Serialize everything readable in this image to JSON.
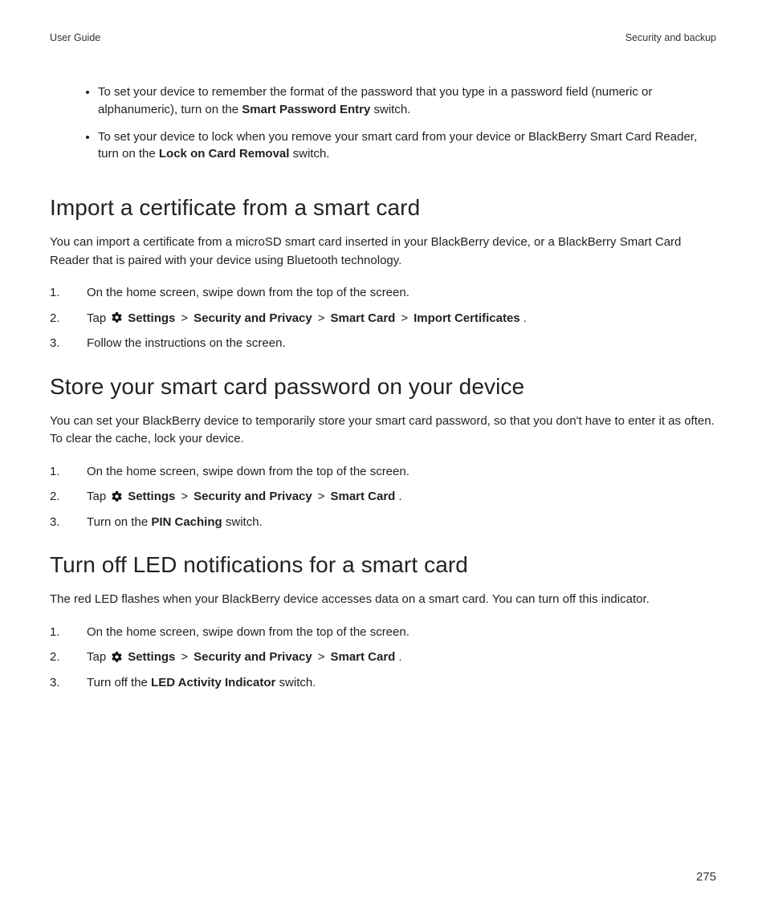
{
  "header": {
    "left": "User Guide",
    "right": "Security and backup"
  },
  "page_number": "275",
  "top_bullets": [
    {
      "pre": "To set your device to remember the format of the password that you type in a password field (numeric or alphanumeric), turn on the ",
      "bold": "Smart Password Entry",
      "post": " switch."
    },
    {
      "pre": "To set your device to lock when you remove your smart card from your device or BlackBerry Smart Card Reader, turn on the ",
      "bold": "Lock on Card Removal",
      "post": " switch."
    }
  ],
  "sections": {
    "import": {
      "heading": "Import a certificate from a smart card",
      "intro": "You can import a certificate from a microSD smart card inserted in your BlackBerry device, or a BlackBerry Smart Card Reader that is paired with your device using Bluetooth technology.",
      "step1": "On the home screen, swipe down from the top of the screen.",
      "step2": {
        "tap": "Tap",
        "settings": "Settings",
        "sep": ">",
        "security": "Security and Privacy",
        "smartcard": "Smart Card",
        "import": "Import Certificates",
        "period": "."
      },
      "step3": "Follow the instructions on the screen."
    },
    "store": {
      "heading": "Store your smart card password on your device",
      "intro": "You can set your BlackBerry device to temporarily store your smart card password, so that you don't have to enter it as often. To clear the cache, lock your device.",
      "step1": "On the home screen, swipe down from the top of the screen.",
      "step2": {
        "tap": "Tap",
        "settings": "Settings",
        "sep": ">",
        "security": "Security and Privacy",
        "smartcard": "Smart Card",
        "period": "."
      },
      "step3_pre": "Turn on the ",
      "step3_bold": "PIN Caching",
      "step3_post": " switch."
    },
    "led": {
      "heading": "Turn off LED notifications for a smart card",
      "intro": "The red LED flashes when your BlackBerry device accesses data on a smart card. You can turn off this indicator.",
      "step1": "On the home screen, swipe down from the top of the screen.",
      "step2": {
        "tap": "Tap",
        "settings": "Settings",
        "sep": ">",
        "security": "Security and Privacy",
        "smartcard": "Smart Card",
        "period": "."
      },
      "step3_pre": "Turn off the ",
      "step3_bold": "LED Activity Indicator",
      "step3_post": " switch."
    }
  }
}
